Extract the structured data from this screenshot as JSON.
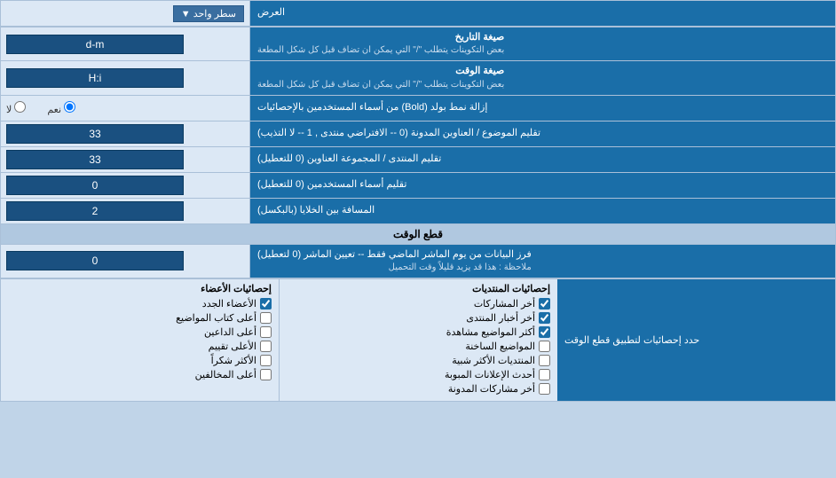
{
  "header": {
    "label_right": "العرض",
    "dropdown_label": "سطر واحد",
    "dropdown_icon": "▼"
  },
  "rows": [
    {
      "id": "date_format",
      "label": "صيغة التاريخ",
      "sublabel": "بعض التكوينات يتطلب \"/\" التي يمكن ان تضاف قبل كل شكل المطعة",
      "value": "d-m"
    },
    {
      "id": "time_format",
      "label": "صيغة الوقت",
      "sublabel": "بعض التكوينات يتطلب \"/\" التي يمكن ان تضاف قبل كل شكل المطعة",
      "value": "H:i"
    },
    {
      "id": "bold_remove",
      "label": "إزالة نمط بولد (Bold) من أسماء المستخدمين بالإحصائيات",
      "radio_yes": "نعم",
      "radio_no": "لا",
      "selected": "نعم"
    },
    {
      "id": "topic_titles",
      "label": "تقليم الموضوع / العناوين المدونة (0 -- الافتراضي منتدى , 1 -- لا التذيب)",
      "value": "33"
    },
    {
      "id": "forum_titles",
      "label": "تقليم المنتدى / المجموعة العناوين (0 للتعطيل)",
      "value": "33"
    },
    {
      "id": "usernames",
      "label": "تقليم أسماء المستخدمين (0 للتعطيل)",
      "value": "0"
    },
    {
      "id": "cell_spacing",
      "label": "المسافة بين الخلايا (بالبكسل)",
      "value": "2"
    }
  ],
  "section_cutoff": {
    "title": "قطع الوقت",
    "row": {
      "label": "فرز البيانات من يوم الماشر الماضي فقط -- تعيين الماشر (0 لتعطيل)",
      "note": "ملاحظة : هذا قد يزيد قليلاً وقت التحميل",
      "value": "0"
    },
    "limit_label": "حدد إحصائيات لتطبيق قطع الوقت"
  },
  "checkboxes": {
    "col1": {
      "title": "إحصائيات المنتديات",
      "items": [
        "أخر المشاركات",
        "أخر أخبار المنتدى",
        "أكثر المواضيع مشاهدة",
        "المواضيع الساخنة",
        "المنتديات الأكثر شبية",
        "أحدث الإعلانات المبوبة",
        "أخر مشاركات المدونة"
      ]
    },
    "col2": {
      "title": "إحصائيات الأعضاء",
      "items": [
        "الأعضاء الجدد",
        "أعلى كتاب المواضيع",
        "أعلى الداعين",
        "الأعلى تقييم",
        "الأكثر شكراً",
        "أعلى المخالفين"
      ]
    }
  }
}
